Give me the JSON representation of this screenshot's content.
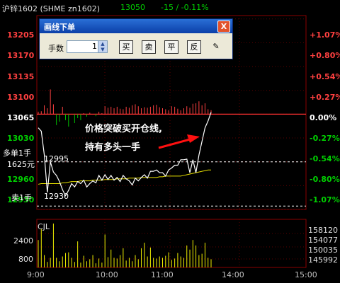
{
  "header": {
    "symbol": "沪锌1602 (SHME zn1602)",
    "price": "13050",
    "change": "-15 / -0.11%"
  },
  "price_axis": {
    "labels": [
      "13205",
      "13170",
      "13135",
      "13100",
      "13065",
      "13030",
      "12995",
      "12960",
      "12930"
    ],
    "pct_labels": [
      "+1.07%",
      "+0.80%",
      "+0.54%",
      "+0.27%",
      "0.00%",
      "-0.27%",
      "-0.54%",
      "-0.80%",
      "-1.07%"
    ]
  },
  "time_axis": [
    "9:00",
    "10:00",
    "11:00",
    "14:00",
    "15:00"
  ],
  "levels": {
    "long_tag": "多单1手",
    "long_price": "1625元",
    "upper_level": "12995",
    "short_tag": "卖1手",
    "lower_level": "12930"
  },
  "annotation": {
    "line1": "价格突破买开仓线,",
    "line2": "持有多头一手"
  },
  "volume_panel": {
    "label": "CJL",
    "left_labels": [
      "2400",
      "1600",
      "800"
    ],
    "right_labels": [
      "158120",
      "154077",
      "150035",
      "145992"
    ]
  },
  "dialog": {
    "title": "画线下单",
    "qty_label": "手数",
    "qty_value": "1",
    "buttons": [
      "买",
      "卖",
      "平",
      "反",
      "✎"
    ],
    "close_symbol": "X"
  },
  "colors": {
    "up": "#ff4040",
    "down": "#00c000",
    "price_line": "#ffffff",
    "avg_line": "#e8e000",
    "volume": "#f0f000",
    "dashed_level": "#ffffff",
    "header_price": "#00d000"
  },
  "chart_data": {
    "type": "line",
    "price_series": [
      13045,
      13040,
      13005,
      12950,
      12995,
      12980,
      12975,
      12966,
      12954,
      12945,
      12953,
      12963,
      12958,
      12966,
      12963,
      12968,
      12958,
      12963,
      12967,
      12964,
      12975,
      12968,
      12976,
      12969,
      12975,
      12968,
      12972,
      12966,
      12975,
      12970,
      12967,
      12961,
      12971,
      12967,
      12972,
      12976,
      12971,
      12981,
      12981,
      12983,
      12979,
      12979,
      12974,
      12983,
      12986,
      12990,
      12990,
      12998,
      12998,
      12999,
      12979,
      12998,
      12979,
      13005,
      13025,
      13045,
      13055,
      13068
    ],
    "avg_series": [
      12962,
      12963,
      12963,
      12963,
      12963,
      12963,
      12963,
      12963,
      12964,
      12964,
      12965,
      12966,
      12966,
      12966,
      12967,
      12967,
      12967,
      12967,
      12968,
      12968,
      12968,
      12968,
      12969,
      12969,
      12969,
      12969,
      12970,
      12970,
      12970,
      12970,
      12971,
      12971,
      12971,
      12971,
      12972,
      12972,
      12972,
      12972,
      12972,
      12972,
      12973,
      12973,
      12974,
      12974,
      12974,
      12974,
      12974,
      12974,
      12975,
      12976,
      12977,
      12978,
      12979,
      12980,
      12981,
      12982,
      12983,
      12983
    ],
    "pct_bars": [
      0.05,
      0.06,
      0.18,
      0.12,
      0.5,
      0.2,
      -0.22,
      -0.15,
      0.15,
      -0.12,
      -0.25,
      0.0,
      -0.18,
      -0.08,
      -0.12,
      0.02,
      -0.05,
      0.03,
      0.0,
      -0.04,
      0.05,
      0.02,
      0.16,
      0.13,
      0.15,
      0.12,
      0.15,
      0.11,
      0.1,
      0.15,
      0.13,
      0.18,
      0.2,
      0.16,
      0.12,
      0.14,
      0.13,
      0.15,
      0.18,
      0.19,
      0.14,
      0.12,
      0.1,
      0.08,
      0.16,
      0.15,
      0.11,
      0.08,
      0.12,
      0.16,
      0.13,
      0.21,
      0.22,
      0.26,
      0.18,
      0.22,
      0.1,
      0.08
    ],
    "volume": [
      2000,
      2800,
      900,
      400,
      700,
      3200,
      700,
      450,
      800,
      1050,
      1100,
      700,
      400,
      1900,
      350,
      850,
      450,
      600,
      900,
      300,
      650,
      350,
      2400,
      750,
      1300,
      700,
      650,
      900,
      1400,
      500,
      700,
      450,
      900,
      600,
      1400,
      1800,
      800,
      1450,
      700,
      650,
      800,
      700,
      850,
      1100,
      550,
      650,
      1050,
      800,
      700,
      1600,
      1300,
      2000,
      1600,
      900,
      1000,
      1800,
      700,
      600
    ],
    "y_range": [
      12925,
      13210
    ],
    "reference_price": 13065,
    "upper_level": 12995,
    "lower_level": 12930
  }
}
